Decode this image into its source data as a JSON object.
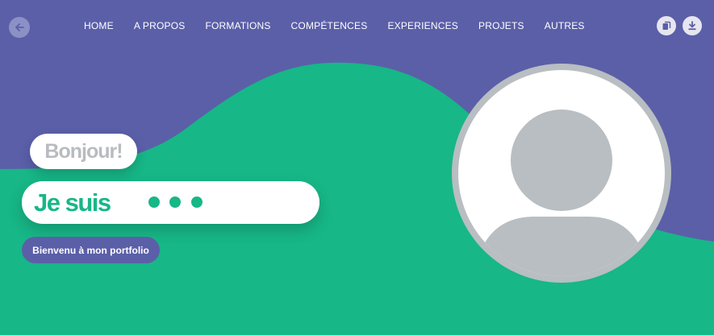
{
  "nav": {
    "items": [
      "HOME",
      "A PROPOS",
      "FORMATIONS",
      "COMPÉTENCES",
      "EXPERIENCES",
      "PROJETS",
      "AUTRES"
    ]
  },
  "hero": {
    "greeting": "Bonjour!",
    "intro": "Je suis",
    "cta_label": "Bienvenu à mon portfolio"
  },
  "icons": {
    "back": "arrow-left-icon",
    "copy": "copy-icon",
    "download": "download-icon",
    "avatar": "user-avatar-icon"
  },
  "colors": {
    "purple": "#5b5fa8",
    "green": "#17b787",
    "avatar_gray": "#b8bec1",
    "white": "#ffffff"
  }
}
